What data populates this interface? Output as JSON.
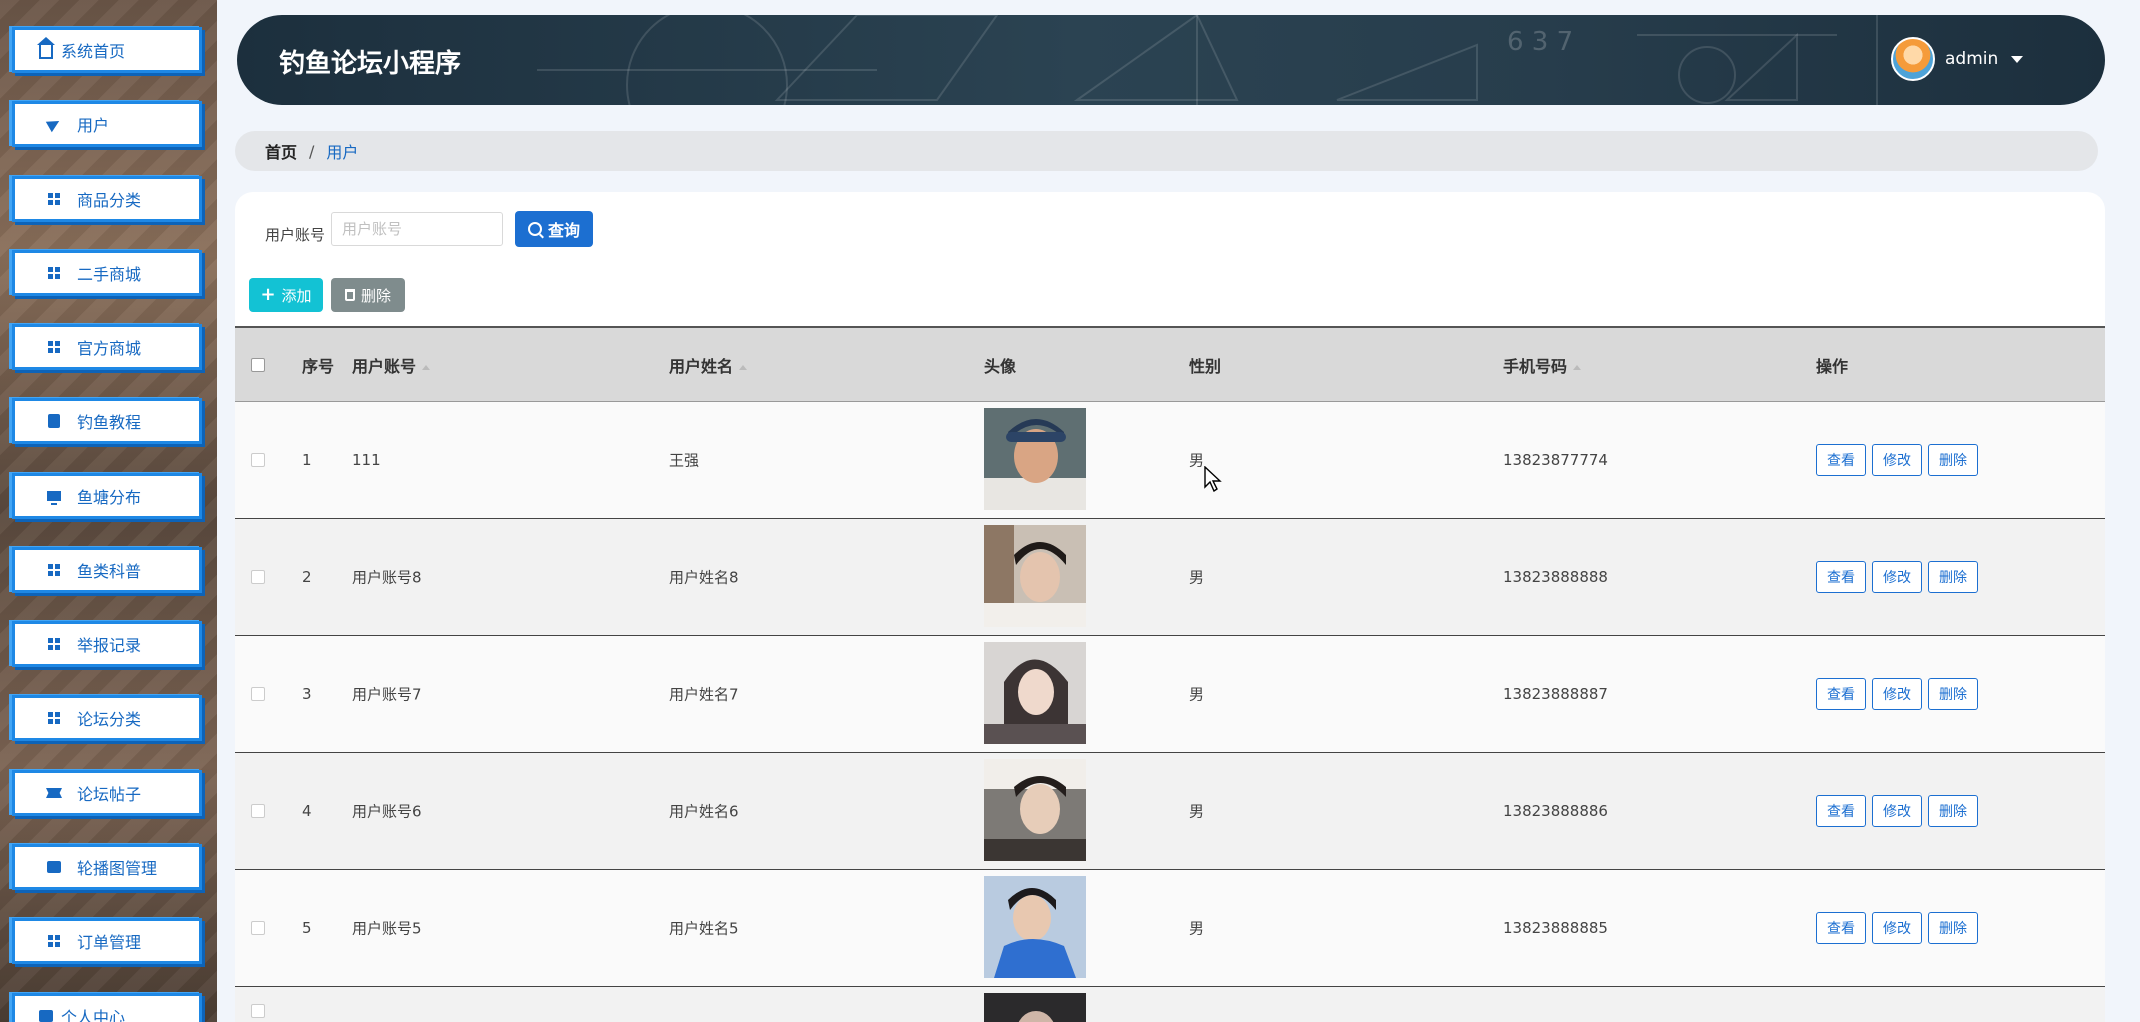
{
  "app": {
    "title": "钓鱼论坛小程序",
    "user": "admin"
  },
  "sidebar": {
    "items": [
      {
        "label": "系统首页",
        "icon": "home-icon"
      },
      {
        "label": "用户",
        "icon": "send-icon"
      },
      {
        "label": "商品分类",
        "icon": "grid-icon"
      },
      {
        "label": "二手商城",
        "icon": "grid-icon"
      },
      {
        "label": "官方商城",
        "icon": "grid-icon"
      },
      {
        "label": "钓鱼教程",
        "icon": "clipboard-icon"
      },
      {
        "label": "鱼塘分布",
        "icon": "monitor-icon"
      },
      {
        "label": "鱼类科普",
        "icon": "grid-icon"
      },
      {
        "label": "举报记录",
        "icon": "grid-icon"
      },
      {
        "label": "论坛分类",
        "icon": "grid-icon"
      },
      {
        "label": "论坛帖子",
        "icon": "ticket-icon"
      },
      {
        "label": "轮播图管理",
        "icon": "card-icon"
      },
      {
        "label": "订单管理",
        "icon": "grid-icon"
      },
      {
        "label": "个人中心",
        "icon": "card-icon"
      }
    ]
  },
  "breadcrumb": {
    "home": "首页",
    "separator": "/",
    "current": "用户"
  },
  "search": {
    "label": "用户账号",
    "placeholder": "用户账号",
    "button": "查询"
  },
  "toolbar": {
    "add": "添加",
    "delete": "删除"
  },
  "table": {
    "headers": {
      "index": "序号",
      "account": "用户账号",
      "name": "用户姓名",
      "avatar": "头像",
      "gender": "性别",
      "phone": "手机号码",
      "actions": "操作"
    },
    "rows": [
      {
        "index": "1",
        "account": "111",
        "name": "王强",
        "gender": "男",
        "phone": "13823877774"
      },
      {
        "index": "2",
        "account": "用户账号8",
        "name": "用户姓名8",
        "gender": "男",
        "phone": "13823888888"
      },
      {
        "index": "3",
        "account": "用户账号7",
        "name": "用户姓名7",
        "gender": "男",
        "phone": "13823888887"
      },
      {
        "index": "4",
        "account": "用户账号6",
        "name": "用户姓名6",
        "gender": "男",
        "phone": "13823888886"
      },
      {
        "index": "5",
        "account": "用户账号5",
        "name": "用户姓名5",
        "gender": "男",
        "phone": "13823888885"
      }
    ],
    "row_actions": {
      "view": "查看",
      "edit": "修改",
      "delete": "删除"
    }
  },
  "header_deco_numbers": "6 3 7"
}
